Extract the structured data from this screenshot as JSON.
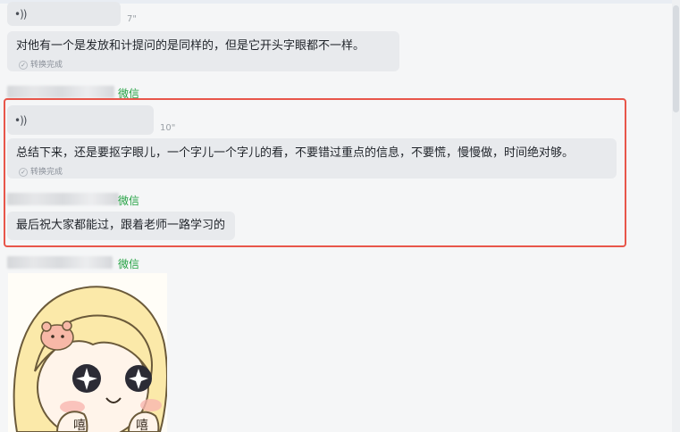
{
  "messages": [
    {
      "id": "m1",
      "type": "voice",
      "duration": "7\""
    },
    {
      "id": "m2",
      "type": "text",
      "text": "对他有一个是发放和计提问的是同样的，但是它开头字眼都不一样。",
      "converted": "转换完成"
    },
    {
      "id": "m3",
      "type": "voice",
      "duration": "10\""
    },
    {
      "id": "m4",
      "type": "text",
      "text": "总结下来，还是要抠字眼儿，一个字儿一个字儿的看，不要错过重点的信息，不要慌，慢慢做，时间绝对够。",
      "converted": "转换完成"
    },
    {
      "id": "m5",
      "type": "text",
      "text": "最后祝大家都能过，跟着老师一路学习的"
    }
  ],
  "sender_tag": "微信",
  "sticker_text": {
    "left": "嘻",
    "right": "嘻"
  },
  "colors": {
    "highlight": "#e8564a",
    "wechat_tag": "#25a244",
    "bubble": "#e8eaed"
  }
}
